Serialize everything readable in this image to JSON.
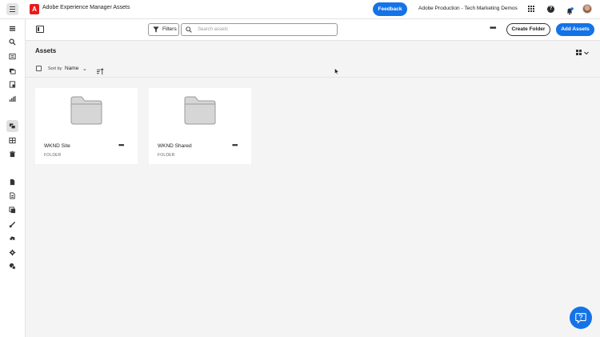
{
  "header": {
    "logo_letter": "A",
    "app_title": "Adobe Experience Manager Assets",
    "feedback_label": "Feedback",
    "org_name": "Adobe Production - Tech Marketing Demos"
  },
  "toolbar": {
    "filters_label": "Filters",
    "search_placeholder": "Search assets",
    "create_folder_label": "Create Folder",
    "add_assets_label": "Add Assets"
  },
  "content": {
    "title": "Assets",
    "sort_label": "Sort by",
    "sort_value": "Name"
  },
  "folders": [
    {
      "name": "WKND Site",
      "type": "FOLDER"
    },
    {
      "name": "WKND Shared",
      "type": "FOLDER"
    }
  ],
  "rail_icons": [
    "home-icon",
    "search-icon",
    "collections-icon",
    "assets-browse-icon",
    "templates-icon",
    "insights-icon",
    "assets-active-icon",
    "grid-icon",
    "trash-icon",
    "document-icon",
    "file-icon",
    "layers-icon",
    "brush-icon",
    "cloud-icon",
    "settings-icon",
    "extensions-icon"
  ],
  "colors": {
    "accent": "#1473e6",
    "brand_red": "#e81b1b"
  }
}
